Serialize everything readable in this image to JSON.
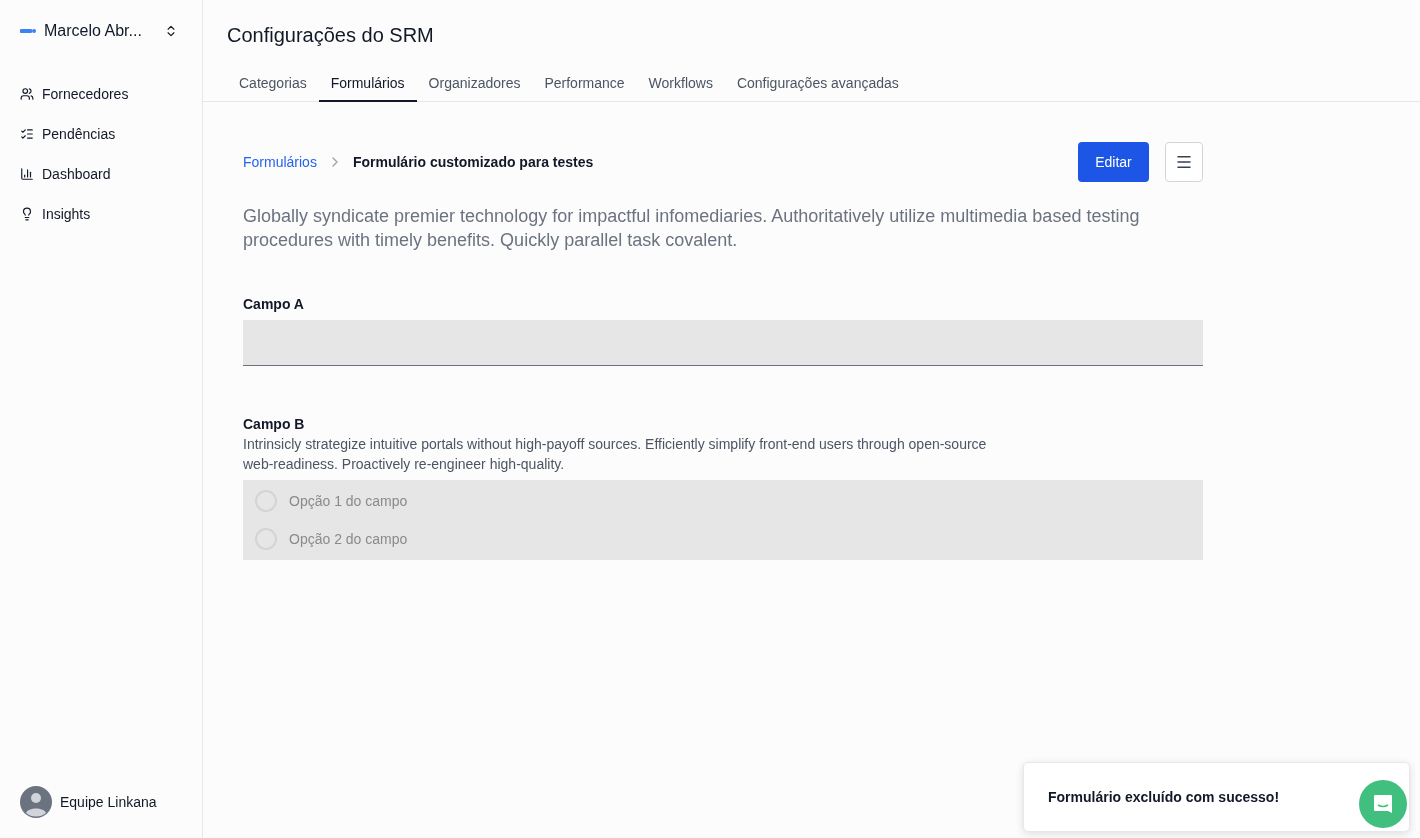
{
  "sidebar": {
    "account": "Marcelo Abr...",
    "items": [
      {
        "label": "Fornecedores",
        "selected": false
      },
      {
        "label": "Pendências",
        "selected": false
      },
      {
        "label": "Dashboard",
        "selected": false
      },
      {
        "label": "Insights",
        "selected": false
      }
    ],
    "user": "Equipe Linkana"
  },
  "header": {
    "title": "Configurações do SRM"
  },
  "tabs": [
    {
      "label": "Categorias",
      "selected": false
    },
    {
      "label": "Formulários",
      "selected": true
    },
    {
      "label": "Organizadores",
      "selected": false
    },
    {
      "label": "Performance",
      "selected": false
    },
    {
      "label": "Workflows",
      "selected": false
    },
    {
      "label": "Configurações avançadas",
      "selected": false
    }
  ],
  "breadcrumb": {
    "parent": "Formulários",
    "current": "Formulário customizado para testes"
  },
  "edit_button": "Editar",
  "description": "Globally syndicate premier technology for impactful infomediaries. Authoritatively utilize multimedia based testing procedures with timely benefits. Quickly parallel task covalent.",
  "fields": [
    {
      "kind": "text",
      "label": "Campo A"
    },
    {
      "kind": "radio",
      "label": "Campo B",
      "help": "Intrinsicly strategize intuitive portals without high-payoff sources. Efficiently simplify front-end users through open-source web-readiness. Proactively re-engineer high-quality.",
      "options": [
        {
          "label": "Opção 1 do campo",
          "selected": false
        },
        {
          "label": "Opção 2 do campo",
          "selected": false
        }
      ]
    }
  ],
  "toast": {
    "message": "Formulário excluído com sucesso!"
  }
}
